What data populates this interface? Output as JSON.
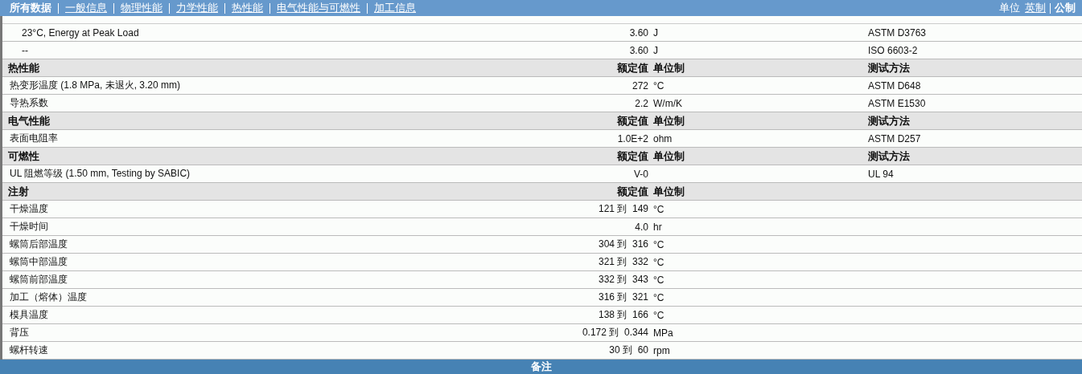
{
  "nav": {
    "tabs": [
      {
        "label": "所有数据",
        "selected": true
      },
      {
        "label": "一般信息",
        "selected": false
      },
      {
        "label": "物理性能",
        "selected": false
      },
      {
        "label": "力学性能",
        "selected": false
      },
      {
        "label": "热性能",
        "selected": false
      },
      {
        "label": "电气性能与可燃性",
        "selected": false
      },
      {
        "label": "加工信息",
        "selected": false
      }
    ],
    "units_label": "单位",
    "unit_options": [
      {
        "label": "英制",
        "selected": false
      },
      {
        "label": "公制",
        "selected": true
      }
    ]
  },
  "rows": [
    {
      "kind": "subdata",
      "name": "23°C, Energy at Peak Load",
      "value": "3.60",
      "unit": "J",
      "method": "ASTM D3763"
    },
    {
      "kind": "subdata",
      "name": "--",
      "value": "3.60",
      "unit": "J",
      "method": "ISO 6603-2"
    },
    {
      "kind": "header",
      "name": "热性能",
      "value": "额定值",
      "unit": "单位制",
      "method": "测试方法"
    },
    {
      "kind": "data",
      "name": "热变形温度  (1.8 MPa, 未退火, 3.20 mm)",
      "value": "272",
      "unit": "°C",
      "method": "ASTM D648"
    },
    {
      "kind": "data",
      "name": "导热系数",
      "value": "2.2",
      "unit": "W/m/K",
      "method": "ASTM E1530"
    },
    {
      "kind": "header",
      "name": "电气性能",
      "value": "额定值",
      "unit": "单位制",
      "method": "测试方法"
    },
    {
      "kind": "data",
      "name": "表面电阻率",
      "value": "1.0E+2",
      "unit": "ohm",
      "method": "ASTM D257"
    },
    {
      "kind": "header",
      "name": "可燃性",
      "value": "额定值",
      "unit": "单位制",
      "method": "测试方法"
    },
    {
      "kind": "data",
      "name": "UL 阻燃等级  (1.50 mm, Testing by SABIC)",
      "value": "V-0",
      "method": "UL 94"
    },
    {
      "kind": "header",
      "name": "注射",
      "value": "额定值",
      "unit": "单位制"
    },
    {
      "kind": "data",
      "name": "干燥温度",
      "value": "121 到  149",
      "unit": "°C"
    },
    {
      "kind": "data",
      "name": "干燥时间",
      "value": "4.0",
      "unit": "hr"
    },
    {
      "kind": "data",
      "name": "螺筒后部温度",
      "value": "304 到  316",
      "unit": "°C"
    },
    {
      "kind": "data",
      "name": "螺筒中部温度",
      "value": "321 到  332",
      "unit": "°C"
    },
    {
      "kind": "data",
      "name": "螺筒前部温度",
      "value": "332 到  343",
      "unit": "°C"
    },
    {
      "kind": "data",
      "name": "加工（熔体）温度",
      "value": "316 到  321",
      "unit": "°C"
    },
    {
      "kind": "data",
      "name": "模具温度",
      "value": "138 到  166",
      "unit": "°C"
    },
    {
      "kind": "data",
      "name": "背压",
      "value": "0.172 到  0.344",
      "unit": "MPa"
    },
    {
      "kind": "data",
      "name": "螺杆转速",
      "value": "30 到  60",
      "unit": "rpm"
    }
  ],
  "footer": {
    "title": "备注"
  }
}
